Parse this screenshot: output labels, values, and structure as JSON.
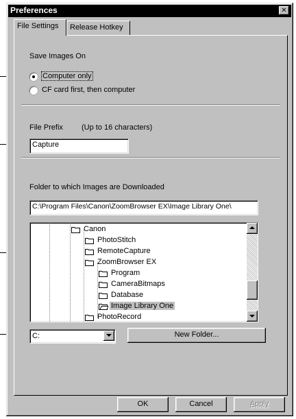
{
  "window": {
    "title": "Preferences"
  },
  "tabs": [
    {
      "label": "File Settings",
      "active": true
    },
    {
      "label": "Release Hotkey",
      "active": false
    }
  ],
  "save_images": {
    "heading": "Save Images On",
    "options": [
      {
        "label": "Computer only",
        "selected": true
      },
      {
        "label": "CF card first, then computer",
        "selected": false
      }
    ]
  },
  "file_prefix": {
    "label": "File Prefix",
    "hint": "(Up to 16 characters)",
    "value": "Capture"
  },
  "download_folder": {
    "label": "Folder to which Images are Downloaded",
    "path": "C:\\Program Files\\Canon\\ZoomBrowser EX\\Image Library One\\",
    "tree": [
      {
        "label": "Canon",
        "depth": 0,
        "open": true
      },
      {
        "label": "PhotoStitch",
        "depth": 1
      },
      {
        "label": "RemoteCapture",
        "depth": 1
      },
      {
        "label": "ZoomBrowser EX",
        "depth": 1,
        "open": true
      },
      {
        "label": "Program",
        "depth": 2
      },
      {
        "label": "CameraBitmaps",
        "depth": 2
      },
      {
        "label": "Database",
        "depth": 2
      },
      {
        "label": "Image Library One",
        "depth": 2,
        "selected": true
      },
      {
        "label": "PhotoRecord",
        "depth": 1
      }
    ],
    "drive": "C:",
    "new_folder_label": "New Folder..."
  },
  "buttons": {
    "ok": "OK",
    "cancel": "Cancel",
    "apply": "Apply"
  },
  "colors": {
    "dialog_bg": "#c0c0c0",
    "title_bar": "#000000",
    "selection": "#c0c0c0"
  },
  "icons": [
    "close-icon",
    "folder-icon",
    "open-folder-icon",
    "scroll-up-arrow",
    "scroll-down-arrow",
    "dropdown-arrow"
  ]
}
